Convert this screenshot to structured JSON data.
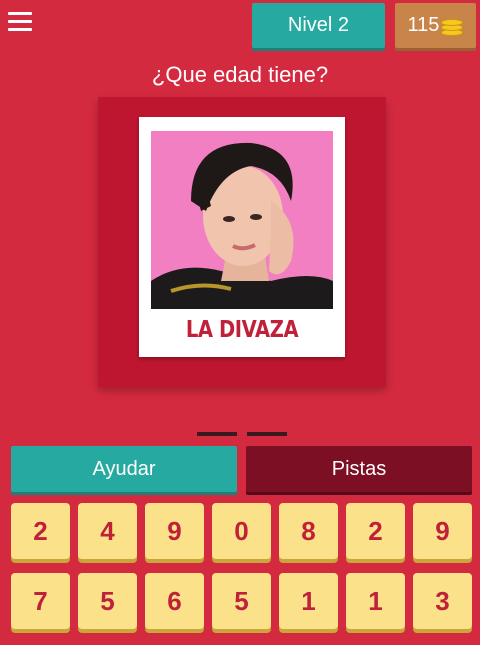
{
  "header": {
    "level_label": "Nivel 2",
    "coins": "115"
  },
  "question": "¿Que edad tiene?",
  "card": {
    "caption": "LA DIVAZA"
  },
  "actions": {
    "help_label": "Ayudar",
    "hints_label": "Pistas"
  },
  "keypad": {
    "row1": [
      "2",
      "4",
      "9",
      "0",
      "8",
      "2",
      "9"
    ],
    "row2": [
      "7",
      "5",
      "6",
      "5",
      "1",
      "1",
      "3"
    ]
  },
  "colors": {
    "background": "#d42a3f",
    "teal": "#26a9a0",
    "coin_bg": "#c9844a",
    "dark_red": "#7c0f23",
    "key_bg": "#fae18a",
    "key_text": "#c0213a"
  }
}
